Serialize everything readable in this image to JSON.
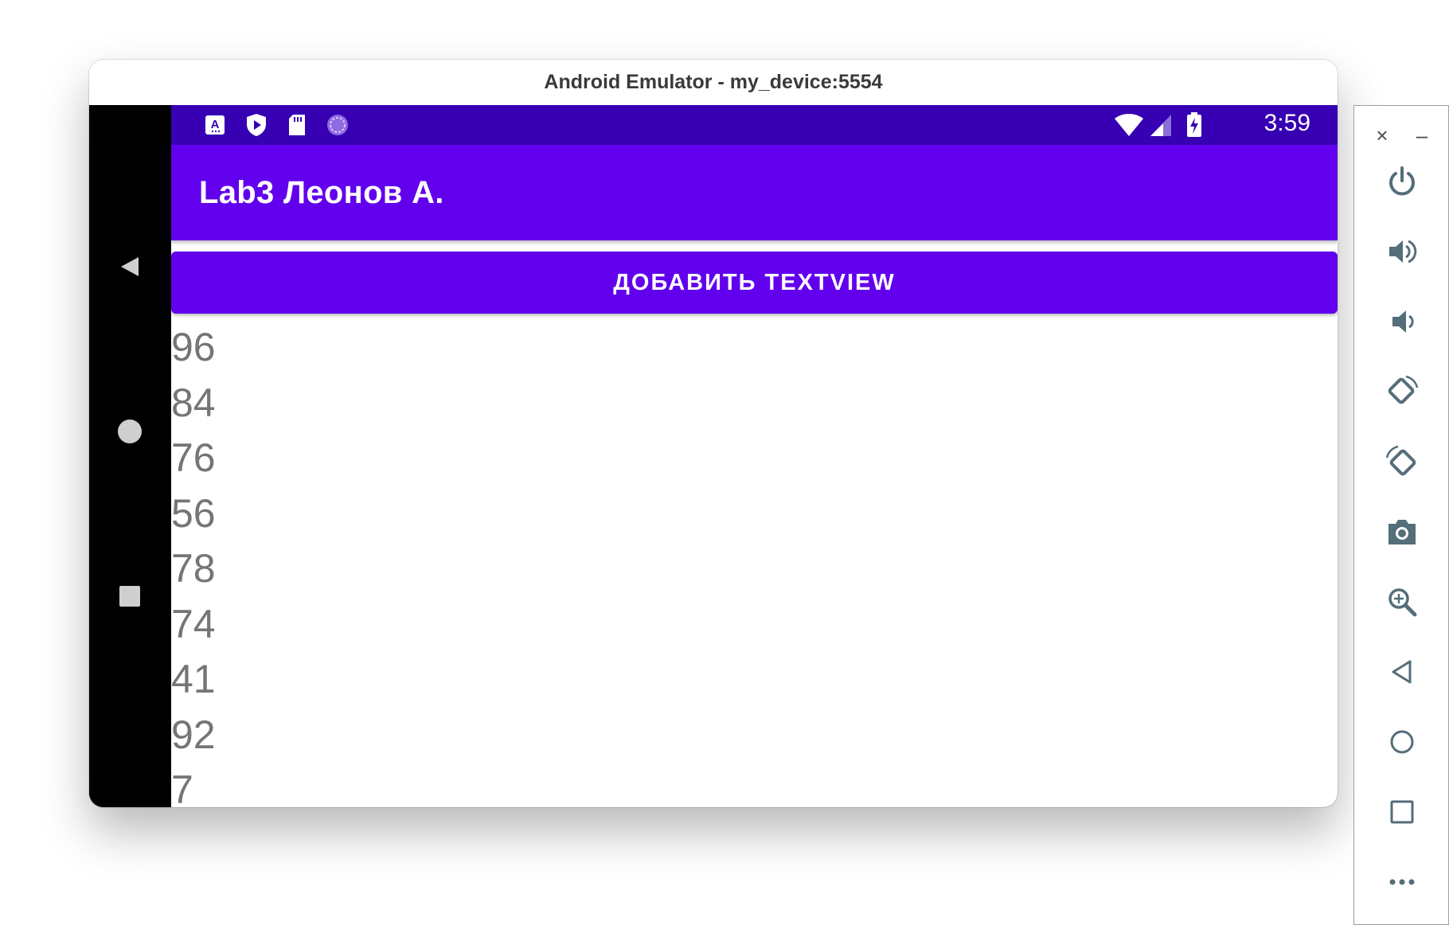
{
  "window": {
    "title": "Android Emulator - my_device:5554"
  },
  "status_bar": {
    "time": "3:59",
    "left_icons": [
      "text-notification-icon",
      "play-protect-icon",
      "sd-card-icon",
      "sync-icon"
    ],
    "right_icons": [
      "wifi-icon",
      "cell-signal-icon",
      "battery-charging-icon"
    ]
  },
  "app_bar": {
    "title": "Lab3 Леонов А."
  },
  "main": {
    "add_button_label": "ДОБАВИТЬ TEXTVIEW",
    "numbers": [
      "96",
      "84",
      "76",
      "56",
      "78",
      "74",
      "41",
      "92",
      "7"
    ]
  },
  "nav_bar": {
    "buttons": [
      "back-icon",
      "home-icon",
      "recents-icon"
    ]
  },
  "side_panel": {
    "close_label": "×",
    "minimize_label": "–",
    "buttons": [
      "power-icon",
      "volume-up-icon",
      "volume-down-icon",
      "rotate-left-icon",
      "rotate-right-icon",
      "camera-icon",
      "zoom-icon",
      "back-icon",
      "home-icon",
      "overview-icon",
      "more-icon"
    ]
  },
  "colors": {
    "status_bar": "#3700b3",
    "primary": "#6200ee",
    "number_text": "#757575",
    "side_icon": "#546e7a"
  }
}
